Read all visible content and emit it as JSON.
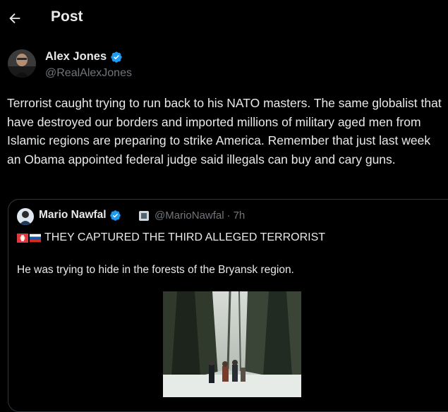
{
  "header": {
    "title": "Post"
  },
  "post": {
    "author_name": "Alex Jones",
    "author_handle": "@RealAlexJones",
    "text": "Terrorist caught trying to run back to his NATO masters. The same globalist that have destroyed our borders and imported millions of military aged men from Islamic regions are preparing to strike America. Remember that just last week an Obama appointed federal judge said illegals can buy and cary guns."
  },
  "quote": {
    "author_name": "Mario Nawfal",
    "author_handle": "@MarioNawfal",
    "separator": "·",
    "time": "7h",
    "headline": "THEY CAPTURED THE THIRD ALLEGED TERRORIST",
    "body": "He was trying to hide in the forests of the Bryansk region."
  },
  "colors": {
    "background": "#000000",
    "text_primary": "#e7e9ea",
    "text_secondary": "#71767b",
    "verified_blue": "#1d9bf0",
    "border": "#333639"
  },
  "icons": {
    "back": "arrow-left-icon",
    "verified": "verified-badge-icon",
    "affiliation": "affiliation-badge-icon",
    "flags": [
      "russian-flag-icon",
      "siren-flag-icon"
    ]
  }
}
